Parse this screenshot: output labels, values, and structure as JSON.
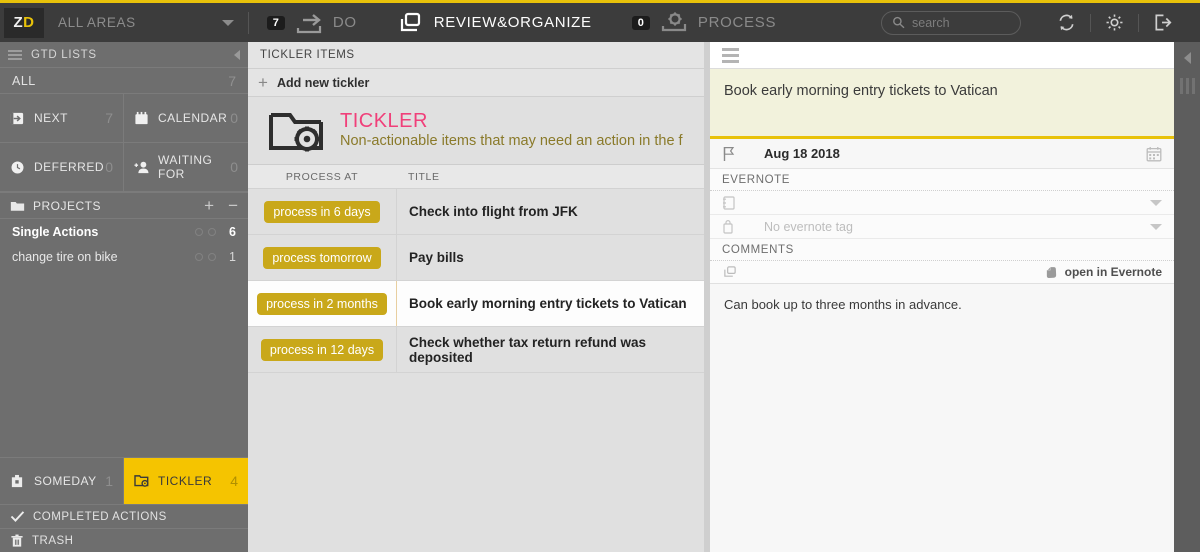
{
  "topbar": {
    "logo_z": "ZD",
    "area_selector": "ALL AREAS",
    "nav": [
      {
        "badge": "7",
        "label": "DO",
        "icon": "arrow-right-icon",
        "active": false
      },
      {
        "badge": "",
        "label": "REVIEW&ORGANIZE",
        "icon": "copy-icon",
        "active": true
      },
      {
        "badge": "0",
        "label": "PROCESS",
        "icon": "gear-icon",
        "active": false
      }
    ],
    "search_placeholder": "search",
    "icons": [
      "sync-icon",
      "settings-icon",
      "logout-icon"
    ]
  },
  "sidebar": {
    "header": "GTD LISTS",
    "all": {
      "label": "ALL",
      "count": "7"
    },
    "grid": [
      {
        "label": "NEXT",
        "count": "7",
        "icon": "next-icon"
      },
      {
        "label": "CALENDAR",
        "count": "0",
        "icon": "calendar-icon"
      },
      {
        "label": "DEFERRED",
        "count": "0",
        "icon": "clock-icon"
      },
      {
        "label": "WAITING FOR",
        "count": "0",
        "icon": "person-add-icon"
      }
    ],
    "projects_header": {
      "label": "PROJECTS",
      "add": "+",
      "remove": "−",
      "icon": "folder-icon"
    },
    "projects": [
      {
        "name": "Single Actions",
        "count": "6",
        "bold": true
      },
      {
        "name": "change tire on bike",
        "count": "1",
        "bold": false
      }
    ],
    "bottom_grid": [
      {
        "label": "SOMEDAY",
        "count": "1",
        "icon": "archive-icon",
        "active": false
      },
      {
        "label": "TICKLER",
        "count": "4",
        "icon": "tickler-folder-icon",
        "active": true
      }
    ],
    "rows": [
      {
        "label": "COMPLETED ACTIONS",
        "icon": "check-icon"
      },
      {
        "label": "TRASH",
        "icon": "trash-icon"
      }
    ]
  },
  "list": {
    "header": "TICKLER ITEMS",
    "add_new": "Add new tickler",
    "banner": {
      "title": "TICKLER",
      "description": "Non-actionable items that may need an action in the f",
      "icon": "folder-gear-icon"
    },
    "columns": {
      "when": "PROCESS AT",
      "title": "TITLE"
    },
    "rows": [
      {
        "when": "process in 6 days",
        "title": "Check into flight from JFK",
        "selected": false
      },
      {
        "when": "process tomorrow",
        "title": "Pay bills",
        "selected": false
      },
      {
        "when": "process in 2 months",
        "title": "Book early morning entry tickets to Vatican",
        "selected": true
      },
      {
        "when": "process in 12 days",
        "title": "Check whether tax return refund was deposited",
        "selected": false
      }
    ]
  },
  "detail": {
    "title_value": "Book early morning entry tickets to Vatican",
    "date_value": "Aug 18 2018",
    "evernote_label": "EVERNOTE",
    "notebook_value": "",
    "tag_value": "No evernote tag",
    "comments_label": "COMMENTS",
    "open_in_evernote": "open in Evernote",
    "comment_text": "Can book up to three months in advance."
  },
  "colors": {
    "accent_yellow": "#e8c20a",
    "tickler_active": "#f5c400",
    "badge": "#c9a81a",
    "pink_title": "#f0407a",
    "olive_desc": "#8a7a2a"
  }
}
